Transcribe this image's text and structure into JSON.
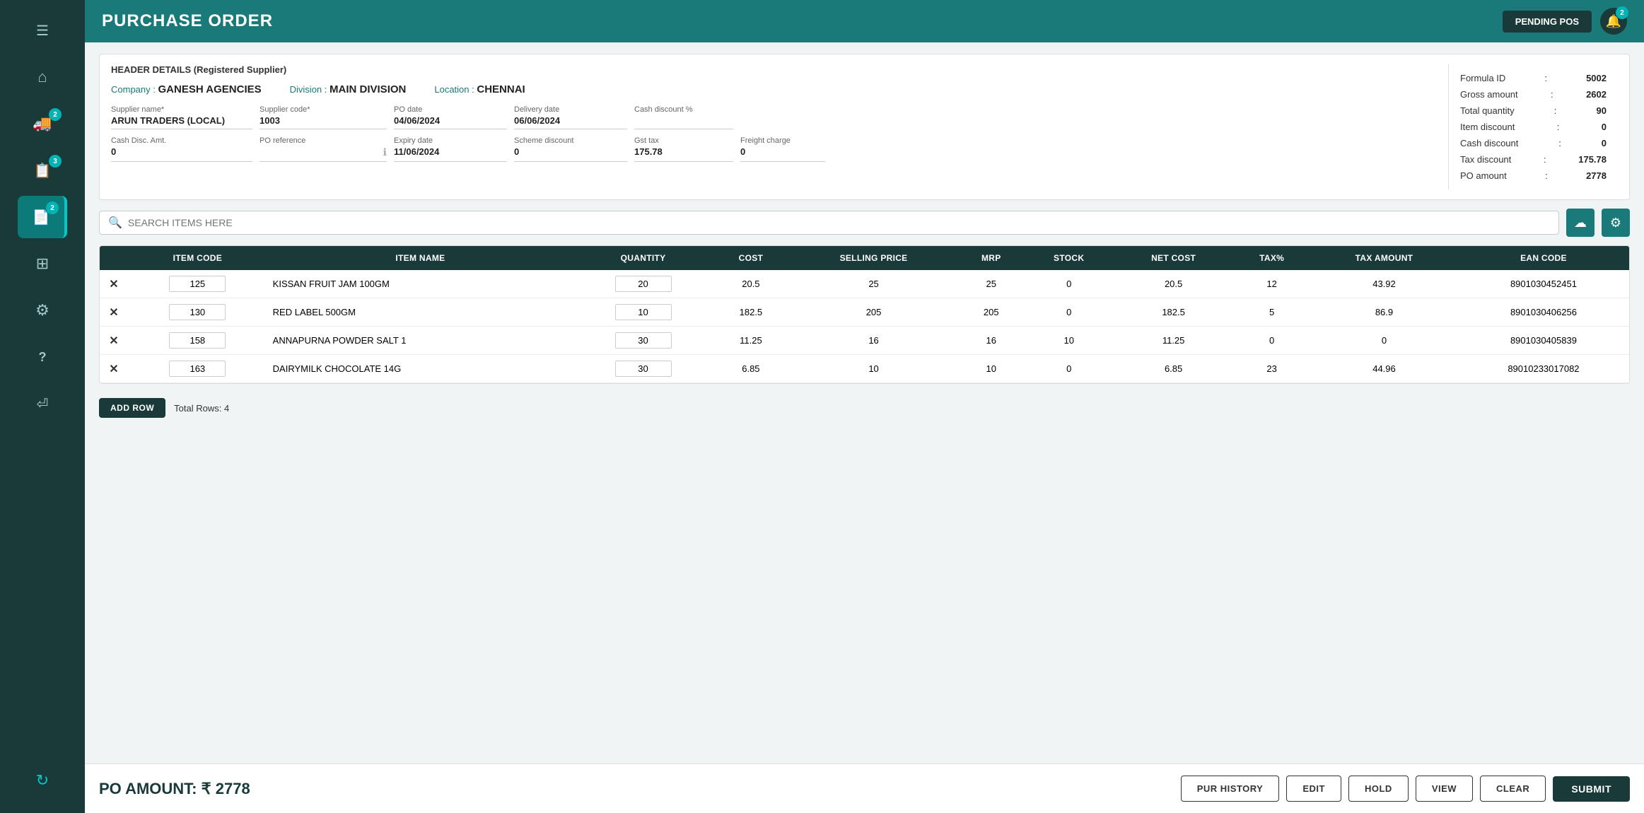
{
  "sidebar": {
    "icons": [
      {
        "name": "menu-icon",
        "symbol": "☰",
        "active": false
      },
      {
        "name": "home-icon",
        "symbol": "⌂",
        "active": false
      },
      {
        "name": "truck-icon",
        "symbol": "🚚",
        "active": false,
        "badge": "2"
      },
      {
        "name": "clipboard-icon",
        "symbol": "📋",
        "active": false,
        "badge": "3"
      },
      {
        "name": "purchase-order-icon",
        "symbol": "📄",
        "active": true,
        "badge": "2"
      },
      {
        "name": "grid-icon",
        "symbol": "⊞",
        "active": false
      },
      {
        "name": "settings-icon",
        "symbol": "⚙",
        "active": false
      },
      {
        "name": "help-icon",
        "symbol": "?",
        "active": false
      },
      {
        "name": "logout-icon",
        "symbol": "⏎",
        "active": false
      },
      {
        "name": "sync-icon",
        "symbol": "↻",
        "active": false
      }
    ]
  },
  "topbar": {
    "title": "PURCHASE ORDER",
    "pending_pos_label": "PENDING POS",
    "notification_count": "2"
  },
  "header_card": {
    "section_title": "HEADER DETAILS (Registered Supplier)",
    "company_label": "Company :",
    "company_value": "GANESH AGENCIES",
    "division_label": "Division :",
    "division_value": "MAIN DIVISION",
    "location_label": "Location :",
    "location_value": "CHENNAI",
    "supplier_name_label": "Supplier name*",
    "supplier_name_value": "ARUN TRADERS (LOCAL)",
    "supplier_code_label": "Supplier code*",
    "supplier_code_value": "1003",
    "po_date_label": "PO date",
    "po_date_value": "04/06/2024",
    "delivery_date_label": "Delivery date",
    "delivery_date_value": "06/06/2024",
    "cash_discount_pct_label": "Cash discount %",
    "cash_discount_pct_value": "",
    "cash_disc_amt_label": "Cash Disc. Amt.",
    "cash_disc_amt_value": "0",
    "po_reference_label": "PO reference",
    "po_reference_value": "",
    "expiry_date_label": "Expiry date",
    "expiry_date_value": "11/06/2024",
    "scheme_discount_label": "Scheme discount",
    "scheme_discount_value": "0",
    "gst_tax_label": "Gst tax",
    "gst_tax_value": "175.78",
    "freight_charge_label": "Freight charge",
    "freight_charge_value": "0"
  },
  "summary": {
    "formula_id_label": "Formula ID",
    "formula_id_value": "5002",
    "gross_amount_label": "Gross amount",
    "gross_amount_value": "2602",
    "total_quantity_label": "Total quantity",
    "total_quantity_value": "90",
    "item_discount_label": "Item discount",
    "item_discount_value": "0",
    "cash_discount_label": "Cash discount",
    "cash_discount_value": "0",
    "tax_discount_label": "Tax discount",
    "tax_discount_value": "175.78",
    "po_amount_label": "PO amount",
    "po_amount_value": "2778"
  },
  "search": {
    "placeholder": "SEARCH ITEMS HERE"
  },
  "table": {
    "columns": [
      "ITEM CODE",
      "ITEM NAME",
      "QUANTITY",
      "COST",
      "SELLING PRICE",
      "MRP",
      "STOCK",
      "NET COST",
      "TAX%",
      "TAX AMOUNT",
      "EAN CODE"
    ],
    "rows": [
      {
        "item_code": "125",
        "item_name": "KISSAN FRUIT JAM 100GM",
        "quantity": "20",
        "cost": "20.5",
        "selling_price": "25",
        "mrp": "25",
        "stock": "0",
        "net_cost": "20.5",
        "tax_pct": "12",
        "tax_amount": "43.92",
        "ean_code": "8901030452451"
      },
      {
        "item_code": "130",
        "item_name": "RED LABEL 500GM",
        "quantity": "10",
        "cost": "182.5",
        "selling_price": "205",
        "mrp": "205",
        "stock": "0",
        "net_cost": "182.5",
        "tax_pct": "5",
        "tax_amount": "86.9",
        "ean_code": "8901030406256"
      },
      {
        "item_code": "158",
        "item_name": "ANNAPURNA POWDER SALT 1",
        "quantity": "30",
        "cost": "11.25",
        "selling_price": "16",
        "mrp": "16",
        "stock": "10",
        "net_cost": "11.25",
        "tax_pct": "0",
        "tax_amount": "0",
        "ean_code": "8901030405839"
      },
      {
        "item_code": "163",
        "item_name": "DAIRYMILK CHOCOLATE 14G",
        "quantity": "30",
        "cost": "6.85",
        "selling_price": "10",
        "mrp": "10",
        "stock": "0",
        "net_cost": "6.85",
        "tax_pct": "23",
        "tax_amount": "44.96",
        "ean_code": "89010233017082"
      }
    ]
  },
  "footer": {
    "add_row_label": "ADD ROW",
    "total_rows_label": "Total Rows: 4"
  },
  "bottom_bar": {
    "po_amount_label": "PO AMOUNT: ₹ 2778",
    "pur_history_label": "PUR HISTORY",
    "edit_label": "EDIT",
    "hold_label": "HOLD",
    "view_label": "VIEW",
    "clear_label": "CLEAR",
    "submit_label": "SUBMIT"
  }
}
